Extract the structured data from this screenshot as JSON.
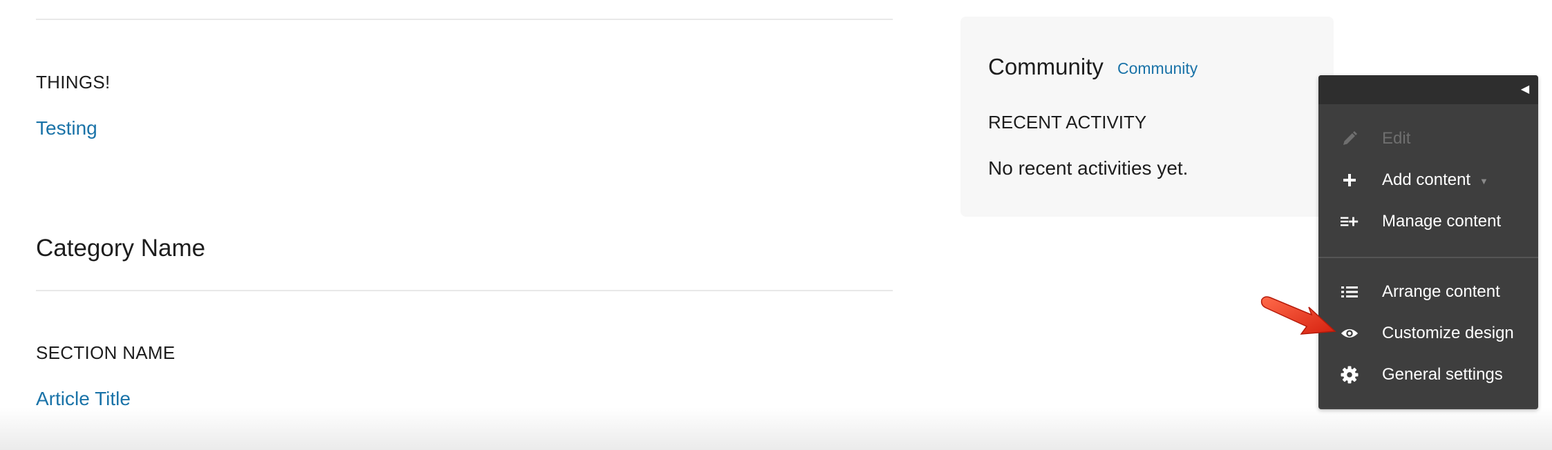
{
  "main": {
    "block1": {
      "heading": "THINGS!",
      "link": "Testing"
    },
    "category_title": "Category Name",
    "block2": {
      "heading": "SECTION NAME",
      "link": "Article Title"
    }
  },
  "community": {
    "title": "Community",
    "link": "Community",
    "recent_heading": "RECENT ACTIVITY",
    "recent_text": "No recent activities yet."
  },
  "admin_panel": {
    "collapse_icon": "triangle-left-icon",
    "items": [
      {
        "label": "Edit",
        "icon": "pencil-icon",
        "disabled": true
      },
      {
        "label": "Add content",
        "icon": "plus-icon",
        "has_dropdown": true
      },
      {
        "label": "Manage content",
        "icon": "list-plus-icon"
      },
      {
        "label": "Arrange content",
        "icon": "list-icon"
      },
      {
        "label": "Customize design",
        "icon": "eye-icon"
      },
      {
        "label": "General settings",
        "icon": "gear-icon"
      }
    ]
  },
  "annotation": {
    "color": "#e8321a"
  },
  "colors": {
    "link": "#1a73a8",
    "panel_bg": "#3e3e3e",
    "panel_top": "#2e2e2e",
    "card_bg": "#f7f7f7"
  }
}
